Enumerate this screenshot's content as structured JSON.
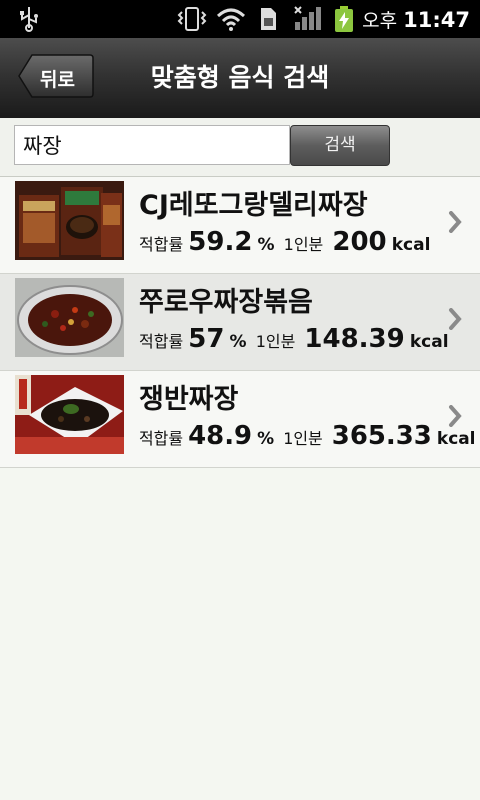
{
  "status_bar": {
    "ampm": "오후",
    "time": "11:47",
    "icons": [
      "usb-icon",
      "vibrate-icon",
      "wifi-icon",
      "sim-icon",
      "signal-icon",
      "battery-charging-icon"
    ]
  },
  "header": {
    "back_label": "뒤로",
    "title": "맞춤형 음식 검색"
  },
  "search": {
    "value": "짜장",
    "button_label": "검색"
  },
  "results": [
    {
      "name": "CJ레또그랑델리짜장",
      "fit_label": "적합률",
      "fit": "59.2",
      "fit_unit": "%",
      "serving_label": "1인분",
      "kcal": "200",
      "kcal_unit": "kcal"
    },
    {
      "name": "쭈로우짜장볶음",
      "fit_label": "적합률",
      "fit": "57",
      "fit_unit": "%",
      "serving_label": "1인분",
      "kcal": "148.39",
      "kcal_unit": "kcal"
    },
    {
      "name": "쟁반짜장",
      "fit_label": "적합률",
      "fit": "48.9",
      "fit_unit": "%",
      "serving_label": "1인분",
      "kcal": "365.33",
      "kcal_unit": "kcal"
    }
  ],
  "colors": {
    "header_bg": "#333333",
    "list_bg": "#f7f8f5",
    "row_alt_bg": "#e7e8e5"
  }
}
